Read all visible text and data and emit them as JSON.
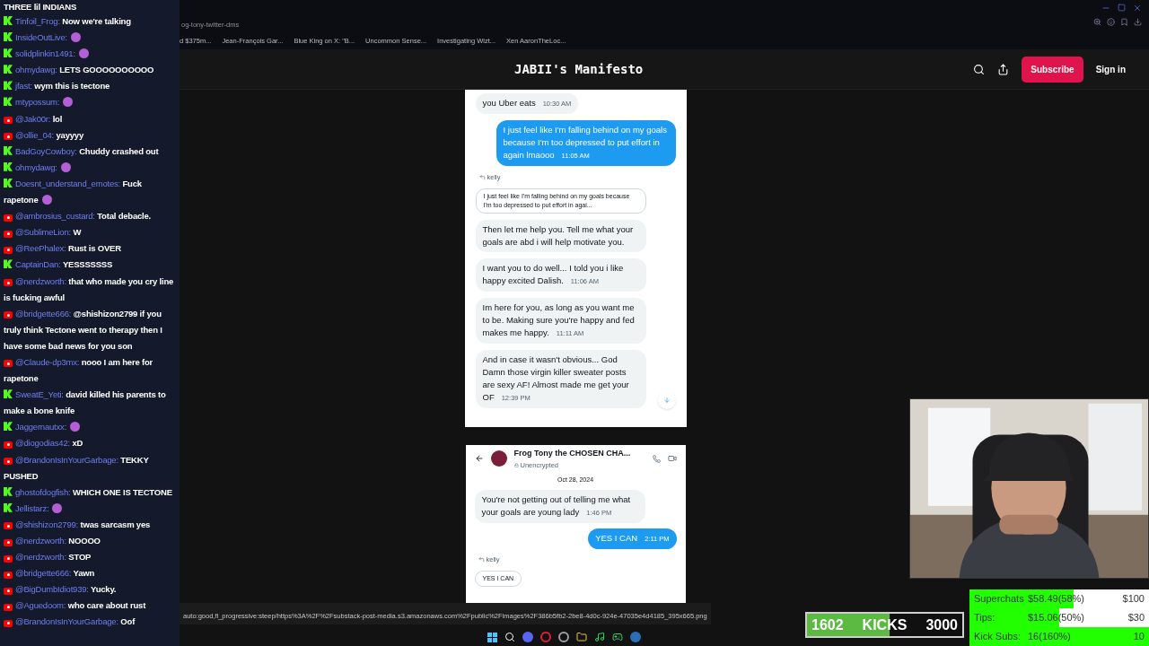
{
  "chat": {
    "title": "THREE lil INDIANS",
    "messages": [
      {
        "kind": "kick",
        "user": "Tinfoil_Frog:",
        "text": "Now we're talking"
      },
      {
        "kind": "kick",
        "user": "InsideOutLive:",
        "emote": true
      },
      {
        "kind": "kick",
        "user": "solidplinkin1491:",
        "emote": true
      },
      {
        "kind": "kick",
        "user": "ohmydawg:",
        "text": "LETS GOOOOOOOOOO"
      },
      {
        "kind": "kick",
        "user": "jfast:",
        "text": "wym this is tectone"
      },
      {
        "kind": "kick",
        "user": "mtypossum:",
        "emote": true
      },
      {
        "kind": "youtube",
        "user": "@Jak00r:",
        "text": "lol"
      },
      {
        "kind": "youtube",
        "user": "@ollie_04:",
        "text": "yayyyy"
      },
      {
        "kind": "kick",
        "user": "BadGoyCowboy:",
        "text": "Chuddy crashed out"
      },
      {
        "kind": "kick",
        "user": "ohmydawg:",
        "emote": true
      },
      {
        "kind": "kick",
        "user": "Doesnt_understand_emotes:",
        "text": "Fuck rapetone",
        "emote": true
      },
      {
        "kind": "youtube",
        "user": "@ambrosius_custard:",
        "text": "Total debacle."
      },
      {
        "kind": "youtube",
        "user": "@SublimeLion:",
        "text": "W"
      },
      {
        "kind": "youtube",
        "user": "@ReePhalex:",
        "text": "Rust is OVER"
      },
      {
        "kind": "kick",
        "user": "CaptainDan:",
        "text": "YESSSSSSS"
      },
      {
        "kind": "youtube",
        "user": "@nerdzworth:",
        "text": "that who made you cry line is fucking awful"
      },
      {
        "kind": "youtube",
        "user": "@bridgette666:",
        "text": "@shishizon2799 if you truly think Tectone went to therapy then I have some bad news for you son"
      },
      {
        "kind": "youtube",
        "user": "@Claude-dp3mx:",
        "text": "nooo I am here for rapetone"
      },
      {
        "kind": "kick",
        "user": "SweatE_Yeti:",
        "text": "david killed his parents to make a bone knife"
      },
      {
        "kind": "kick",
        "user": "Jaggernautxx:",
        "emote": true
      },
      {
        "kind": "youtube",
        "user": "@diogodias42:",
        "text": "xD"
      },
      {
        "kind": "youtube",
        "user": "@BrandonIsInYourGarbage:",
        "text": "TEKKY PUSHED"
      },
      {
        "kind": "kick",
        "user": "ghostofdogfish:",
        "text": "WHICH ONE IS TECTONE"
      },
      {
        "kind": "kick",
        "user": "Jellistarz:",
        "emote": true
      },
      {
        "kind": "youtube",
        "user": "@shishizon2799:",
        "text": "twas sarcasm yes"
      },
      {
        "kind": "youtube",
        "user": "@nerdzworth:",
        "text": "NOOOO"
      },
      {
        "kind": "youtube",
        "user": "@nerdzworth:",
        "text": "STOP"
      },
      {
        "kind": "youtube",
        "user": "@bridgette666:",
        "text": "Yawn"
      },
      {
        "kind": "youtube",
        "user": "@BigDumbIdiot939:",
        "text": "Yucky."
      },
      {
        "kind": "youtube",
        "user": "@Aguedoom:",
        "text": "who care about rust"
      },
      {
        "kind": "youtube",
        "user": "@BrandonIsInYourGarbage:",
        "text": "Oof"
      }
    ]
  },
  "browser": {
    "address": "og-tony-twitter-dms",
    "bookmarks": [
      "d $375m...",
      "Jean-François Gar...",
      "Blue King on X: \"B...",
      "Uncommon Sense...",
      "Investigating Wizt...",
      "Xen AaronTheLoc..."
    ],
    "status_url": "auto:good,fl_progressive:steep/https%3A%2F%2Fsubstack-post-media.s3.amazonaws.com%2Fpublic%2Fimages%2F386b5fb2-2be8-4d0c-924e-47035e4d4185_395x665.png"
  },
  "site": {
    "title": "JABII's Manifesto",
    "subscribe": "Subscribe",
    "sign_in": "Sign in"
  },
  "screenshot_1": {
    "messages": [
      {
        "kind": "received",
        "text": "you Uber eats",
        "time": "10:30 AM"
      },
      {
        "kind": "sent",
        "text": "I just feel like I'm falling behind on my goals because I'm too depressed to put effort in again lmaooo",
        "time": "11:05 AM"
      },
      {
        "kind": "reply_label",
        "text": "kelly"
      },
      {
        "kind": "quote",
        "text": "I just feel like I'm falling behind on my goals because I'm too depressed to put effort in agai..."
      },
      {
        "kind": "received",
        "text": "Then let me help you. Tell me what your goals are abd i will help motivate you."
      },
      {
        "kind": "received",
        "text": "I want you to do well... I told you i like happy excited Dalish.",
        "time": "11:06 AM"
      },
      {
        "kind": "received",
        "text": "Im here for you, as long as you want me to be. Making sure you're happy and fed makes me happy.",
        "time": "11:11 AM"
      },
      {
        "kind": "received",
        "text": "And in case it wasn't obvious... God Damn those virgin killer sweater posts are sexy AF! Almost made me get your OF",
        "time": "12:39 PM"
      }
    ]
  },
  "screenshot_2": {
    "contact": "Frog Tony the CHOSEN CHA...",
    "encryption": "Unencrypted",
    "date": "Oct 28, 2024",
    "messages": [
      {
        "kind": "received",
        "text": "You're not getting out of telling me what your goals are young lady",
        "time": "1:46 PM"
      },
      {
        "kind": "sent",
        "text": "YES I CAN",
        "time": "2:11 PM"
      },
      {
        "kind": "reply_label",
        "text": "kelly"
      },
      {
        "kind": "quote",
        "text": "YES I CAN"
      }
    ]
  },
  "kicks": {
    "current": "1602",
    "label": "KICKS",
    "target": "3000",
    "level": 0.534
  },
  "goals": [
    {
      "label": "Superchats",
      "amount": "$58.49(58%)",
      "target": "$100",
      "level": 0.58
    },
    {
      "label": "Tips:",
      "amount": "$15.06(50%)",
      "target": "$30",
      "level": 0.5
    },
    {
      "label": "Kick Subs:",
      "amount": "16(160%)",
      "target": "10",
      "level": 1
    }
  ]
}
